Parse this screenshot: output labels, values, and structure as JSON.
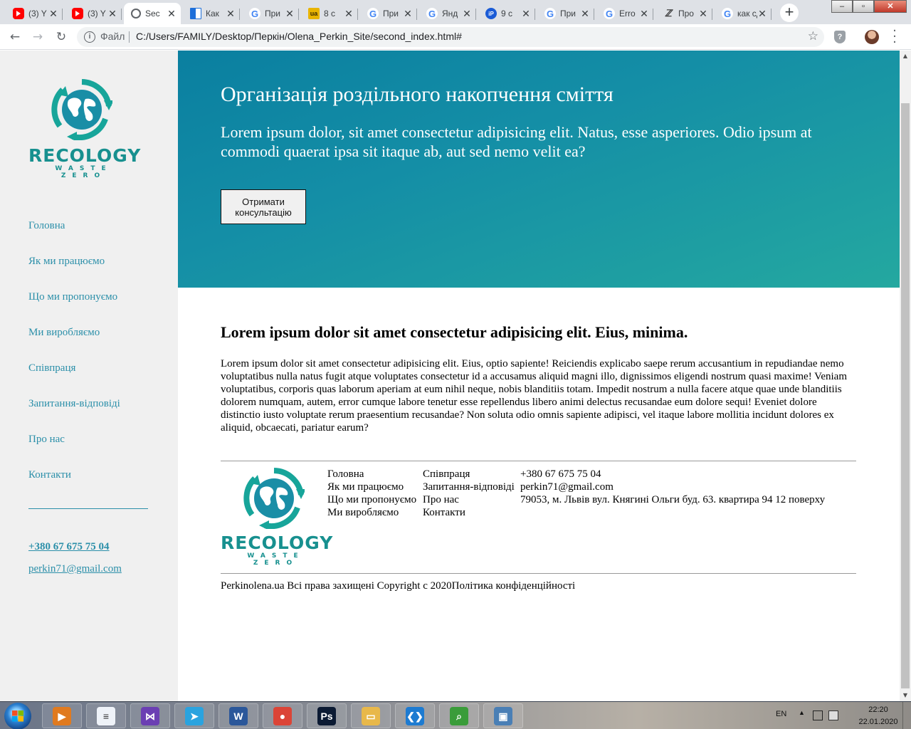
{
  "browser": {
    "tabs": [
      {
        "icon": "youtube-icon",
        "title": "(3) Y"
      },
      {
        "icon": "youtube-icon",
        "title": "(3) Y"
      },
      {
        "icon": "globe-icon",
        "title": "Sec",
        "active": true
      },
      {
        "icon": "window-icon",
        "title": "Как"
      },
      {
        "icon": "google-icon",
        "title": "При"
      },
      {
        "icon": "ua-icon",
        "title": "8 с"
      },
      {
        "icon": "google-icon",
        "title": "При"
      },
      {
        "icon": "google-icon",
        "title": "Янд"
      },
      {
        "icon": "ip-icon",
        "title": "9 с"
      },
      {
        "icon": "google-icon",
        "title": "При"
      },
      {
        "icon": "google-icon",
        "title": "Erro"
      },
      {
        "icon": "zz-icon",
        "title": "Про"
      },
      {
        "icon": "google-icon",
        "title": "как сде"
      }
    ],
    "new_tab": "+",
    "url_scheme": "Файл",
    "url": "C:/Users/FAMILY/Desktop/Перкін/Olena_Perkin_Site/second_index.html#"
  },
  "sidebar": {
    "logo": {
      "brand": "RECOLOGY",
      "tagline": "WASTE ZERO"
    },
    "nav": [
      "Головна",
      "Як ми працюємо",
      "Що ми пропонуємо",
      "Ми виробляємо",
      "Співпраця",
      "Запитання-відповіді",
      "Про нас",
      "Контакти"
    ],
    "phone": "+380 67 675 75 04",
    "email": "perkin71@gmail.com"
  },
  "hero": {
    "title": "Організація роздільного накопчення сміття",
    "text": "Lorem ipsum dolor, sit amet consectetur adipisicing elit. Natus, esse asperiores. Odio ipsum at commodi quaerat ipsa sit itaque ab, aut sed nemo velit ea?",
    "button": "Отримати консультацію"
  },
  "content": {
    "heading": "Lorem ipsum dolor sit amet consectetur adipisicing elit. Eius, minima.",
    "paragraph": "Lorem ipsum dolor sit amet consectetur adipisicing elit. Eius, optio sapiente! Reiciendis explicabo saepe rerum accusantium in repudiandae nemo voluptatibus nulla natus fugit atque voluptates consectetur id a accusamus aliquid magni illo, dignissimos eligendi nostrum quasi maxime! Veniam voluptatibus, corporis quas laborum aperiam at eum nihil neque, nobis blanditiis totam. Impedit nostrum a nulla facere atque quae unde blanditiis dolorem numquam, autem, error cumque labore tenetur esse repellendus libero animi delectus recusandae eum dolore sequi! Eveniet dolore distinctio iusto voluptate rerum praesentium recusandae? Non soluta odio omnis sapiente adipisci, vel itaque labore mollitia incidunt dolores ex aliquid, obcaecati, pariatur earum?"
  },
  "footer": {
    "logo": {
      "brand": "RECOLOGY",
      "tagline": "WASTE ZERO"
    },
    "col1": [
      "Головна",
      "Як ми працюємо",
      "Що ми пропонуємо",
      "Ми виробляємо"
    ],
    "col2": [
      "Співпраця",
      "Запитання-відповіді",
      "Про нас",
      "Контакти"
    ],
    "col3": [
      "+380 67 675 75 04",
      "perkin71@gmail.com",
      "79053, м. Львів вул. Княгині Ольги буд. 63. квартира 94 12 поверху"
    ],
    "copyright": "Perkinolena.ua Всі права захищені Copyright c 2020",
    "policy": "Політика конфіденційності"
  },
  "taskbar": {
    "apps": [
      "media-player-icon",
      "notepad-icon",
      "visual-studio-icon",
      "telegram-icon",
      "word-icon",
      "chrome-icon",
      "photoshop-icon",
      "file-explorer-icon",
      "vscode-icon",
      "search-app-icon",
      "photo-viewer-icon"
    ],
    "language": "EN",
    "time": "22:20",
    "date": "22.01.2020"
  },
  "colors": {
    "accent": "#2b8fa9",
    "brand": "#17908f",
    "hero_start": "#0a7fa0",
    "hero_end": "#24a8a0",
    "sidebar_bg": "#f0f0f0"
  }
}
